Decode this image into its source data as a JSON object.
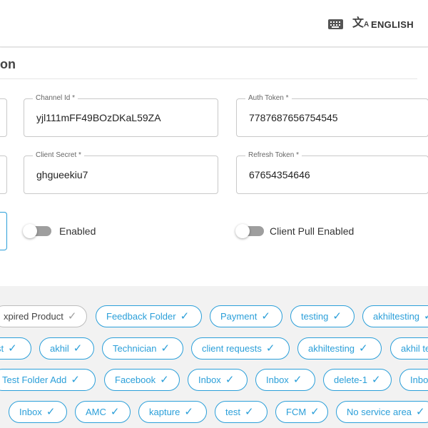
{
  "header": {
    "keyboard_icon": "keyboard-icon",
    "translate_icon": "translate-icon",
    "language": "ENGLISH"
  },
  "section": {
    "title_fragment": "on"
  },
  "fields": {
    "channel_id": {
      "label": "Channel Id *",
      "value": "yjl111mFF49BOzDKaL59ZA"
    },
    "auth_token": {
      "label": "Auth Token *",
      "value": "7787687656754545"
    },
    "client_secret": {
      "label": "Client Secret *",
      "value": "ghgueekiu7"
    },
    "refresh_token": {
      "label": "Refresh Token *",
      "value": "67654354646"
    }
  },
  "toggles": {
    "enabled": {
      "label": "Enabled",
      "on": false
    },
    "client_pull": {
      "label": "Client Pull Enabled",
      "on": false
    }
  },
  "chips": {
    "row1": [
      "xpired Product",
      "Feedback Folder",
      "Payment",
      "testing",
      "akhiltesting"
    ],
    "row2": [
      "st",
      "akhil",
      "Technician",
      "client requests",
      "akhiltesting",
      "akhil te"
    ],
    "row3": [
      "Test Folder Add",
      "Facebook",
      "Inbox",
      "Inbox",
      "delete-1",
      "Inbo"
    ],
    "row4": [
      "Inbox",
      "AMC",
      "kapture",
      "test",
      "FCM",
      "No service area"
    ]
  },
  "colors": {
    "accent": "#2b9fd9",
    "toggle_off": "#9e9e9e",
    "chip_disabled_border": "#bdbdbd"
  }
}
